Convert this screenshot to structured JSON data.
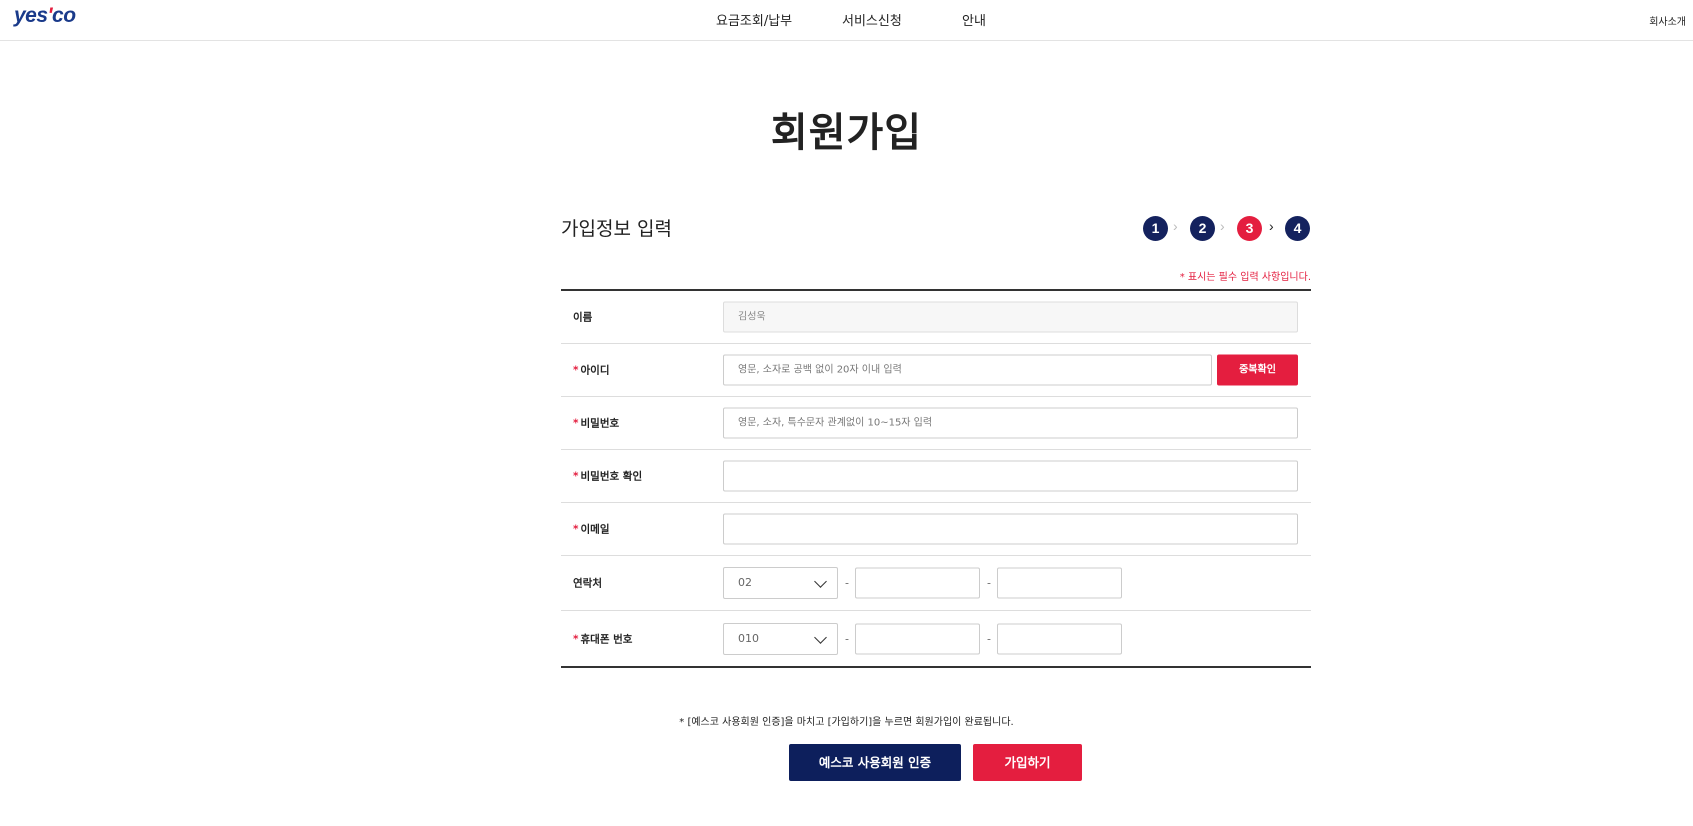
{
  "header": {
    "logo_main": "yes",
    "logo_tick": "'",
    "logo_end": "co",
    "nav": [
      "요금조회/납부",
      "서비스신청",
      "안내"
    ],
    "company_link": "회사소개"
  },
  "page": {
    "title": "회원가입",
    "section_title": "가입정보 입력",
    "steps": [
      "1",
      "2",
      "3",
      "4"
    ],
    "active_step": "3",
    "step_arrow": "›",
    "required_note": "* 표시는 필수 입력 사항입니다."
  },
  "form": {
    "required_mark": "*",
    "name": {
      "label": "이름",
      "value": "김성욱"
    },
    "user_id": {
      "label": "아이디",
      "placeholder": "영문, 소자로 공백 없이 20자 이내 입력",
      "check_button": "중복확인"
    },
    "password": {
      "label": "비밀번호",
      "placeholder": "영문, 소자, 특수문자 관계없이 10~15자 입력"
    },
    "password_confirm": {
      "label": "비밀번호 확인"
    },
    "email": {
      "label": "이메일"
    },
    "phone": {
      "label": "연락처",
      "area_code": "02"
    },
    "mobile": {
      "label": "휴대폰 번호",
      "prefix": "010"
    },
    "dash": "-"
  },
  "footer": {
    "note": "* [예스코 사용회원 인증]을 마치고 [가입하기]을 누르면 회원가입이 완료됩니다.",
    "auth_button": "예스코 사용회원 인증",
    "join_button": "가입하기"
  },
  "colors": {
    "accent_red": "#e41e3f",
    "navy": "#14225e",
    "logo_blue": "#1a3a8a"
  }
}
